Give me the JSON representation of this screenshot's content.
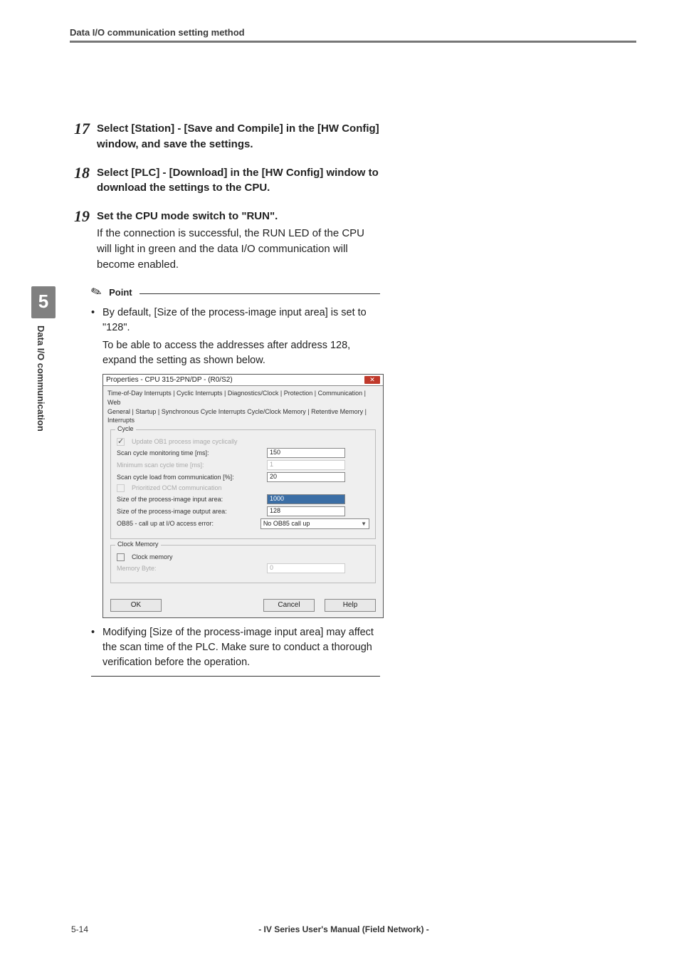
{
  "header": {
    "running": "Data I/O communication setting method"
  },
  "sideTab": {
    "number": "5",
    "label": "Data I/O communication"
  },
  "steps": {
    "s17": {
      "num": "17",
      "head": "Select [Station] - [Save and Compile] in the [HW Config] window, and save the settings."
    },
    "s18": {
      "num": "18",
      "head": "Select [PLC] - [Download] in the [HW Config] window to download the settings to the CPU."
    },
    "s19": {
      "num": "19",
      "head": "Set the CPU mode switch to \"RUN\".",
      "body": "If the connection is successful, the RUN LED of the CPU will light in green and the data I/O communication will become enabled."
    }
  },
  "point": {
    "label": "Point",
    "bullet1a": "By default, [Size of the process-image input area] is set to \"128\".",
    "bullet1b": "To be able to access the addresses after address 128, expand the setting as shown below.",
    "bullet2": "Modifying [Size of the process-image input area] may affect the scan time of the PLC. Make sure to conduct a thorough verification before the operation."
  },
  "dialog": {
    "title": "Properties - CPU 315-2PN/DP - (R0/S2)",
    "tabsTop": "Time-of-Day Interrupts  |  Cyclic Interrupts  |  Diagnostics/Clock  |  Protection  |  Communication  |  Web",
    "tabsBottom": "General  |  Startup  |  Synchronous Cycle Interrupts      Cycle/Clock Memory   |  Retentive Memory  |  Interrupts",
    "groupCycle": "Cycle",
    "row_update": "Update OB1 process image cyclically",
    "row_scanMon": {
      "label": "Scan cycle monitoring time [ms]:",
      "value": "150"
    },
    "row_minScan": {
      "label": "Minimum scan cycle time [ms]:",
      "value": "1"
    },
    "row_scanLoad": {
      "label": "Scan cycle load from communication [%]:",
      "value": "20"
    },
    "row_prioritized": "Prioritized OCM communication",
    "row_inSize": {
      "label": "Size of the process-image input area:",
      "value": "1000"
    },
    "row_outSize": {
      "label": "Size of the process-image output area:",
      "value": "128"
    },
    "row_ob85": {
      "label": "OB85 - call up at I/O access error:",
      "value": "No OB85 call up"
    },
    "groupClock": "Clock Memory",
    "row_clockMem": "Clock memory",
    "row_memByte": {
      "label": "Memory Byte:",
      "value": "0"
    },
    "btn_ok": "OK",
    "btn_cancel": "Cancel",
    "btn_help": "Help"
  },
  "footer": {
    "pageNum": "5-14",
    "center": "- IV Series User's Manual (Field Network) -"
  }
}
